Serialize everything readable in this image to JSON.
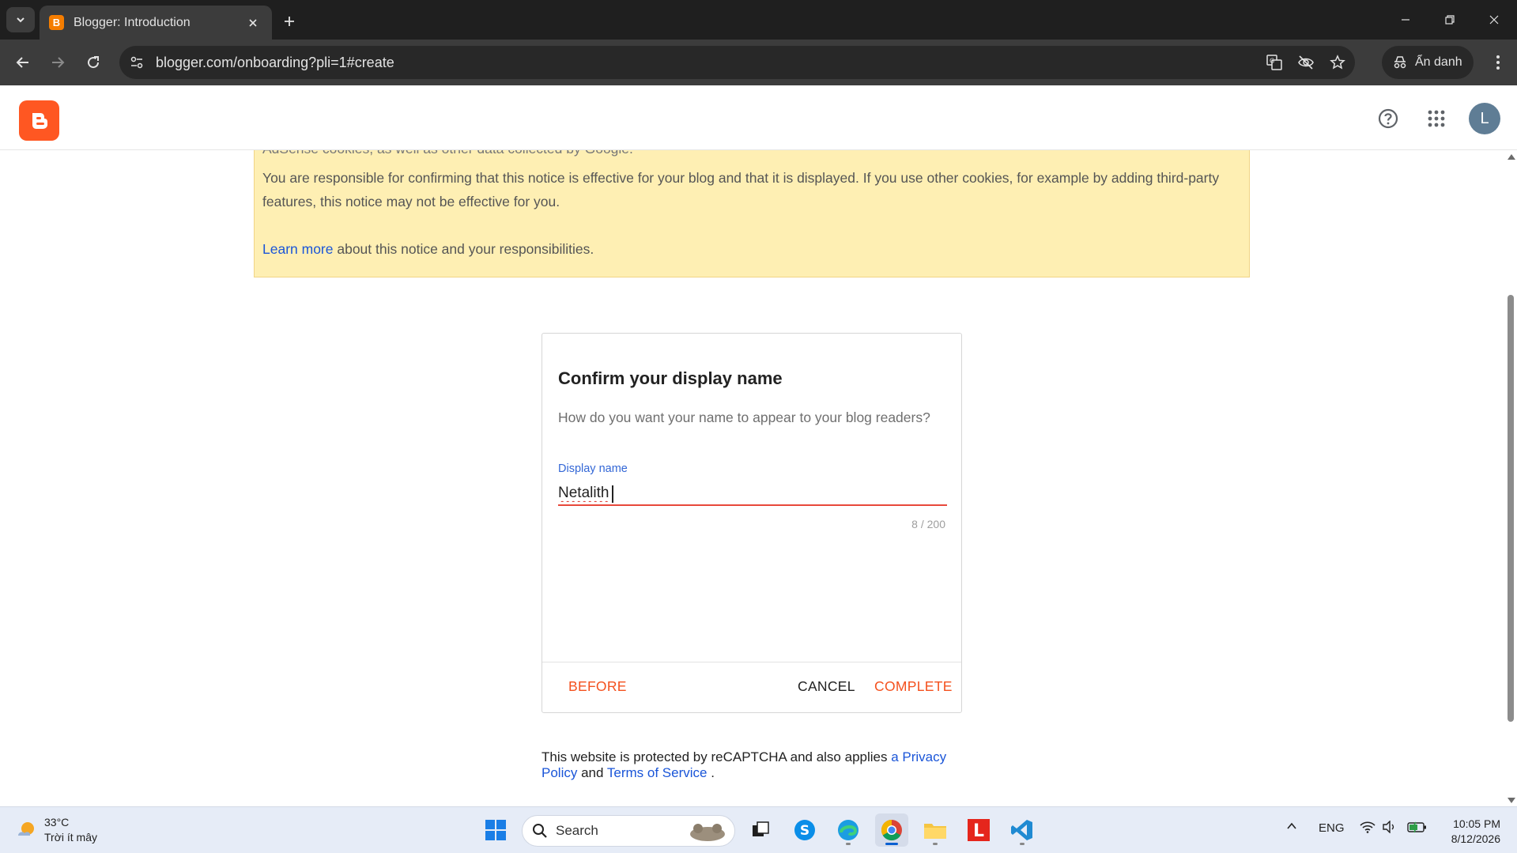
{
  "browser": {
    "tab": {
      "title": "Blogger: Introduction",
      "favicon": "blogger-favicon"
    },
    "url": "blogger.com/onboarding?pli=1#create",
    "profile_label": "Ẩn danh",
    "colors": {
      "chrome_dark": "#1f1f1f",
      "toolbar": "#3c3c3c"
    }
  },
  "header": {
    "logo": "blogger-logo",
    "avatar_letter": "L",
    "brand_color": "#ff5722"
  },
  "notice": {
    "cut_line": "AdSense cookies, as well as other data collected by Google.",
    "paragraph": "You are responsible for confirming that this notice is effective for your blog and that it is displayed. If you use other cookies, for example by adding third-party features, this notice may not be effective for you.",
    "learn_more_link": "Learn more",
    "learn_more_rest": " about this notice and your responsibilities.",
    "background": "#feefb3"
  },
  "dialog": {
    "title": "Confirm your display name",
    "subtitle": "How do you want your name to appear to your blog readers?",
    "field_label": "Display name",
    "field_value": "Netalith",
    "counter": "8 / 200",
    "before_button": "BEFORE",
    "cancel_button": "CANCEL",
    "complete_button": "COMPLETE",
    "accent": "#f4511e"
  },
  "recaptcha": {
    "text_start": "This website is protected by reCAPTCHA and also applies ",
    "privacy_link": "a Privacy Policy",
    "and": " and ",
    "terms_link": "Terms of Service",
    "end": " ."
  },
  "taskbar": {
    "weather_temp": "33°C",
    "weather_desc": "Trời ít mây",
    "search_placeholder": "Search",
    "language": "ENG",
    "time": "10:05 PM",
    "date": "8/12/2026"
  }
}
